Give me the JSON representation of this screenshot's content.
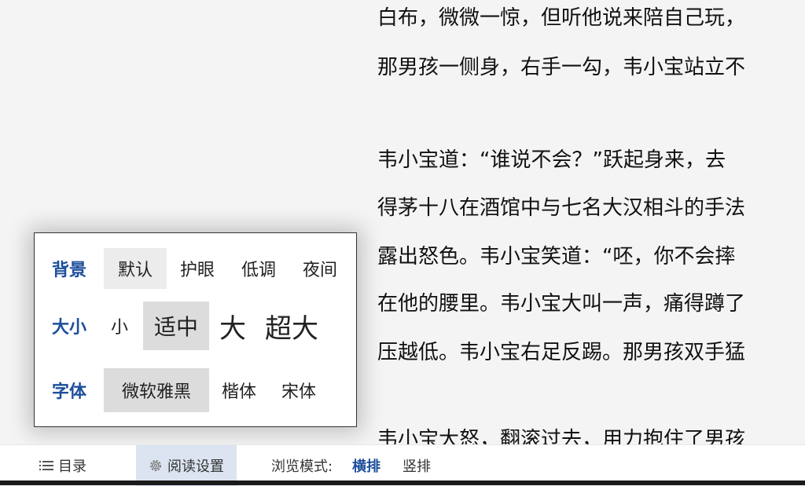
{
  "content": {
    "lines": [
      "白布，微微一惊，但听他说来陪自己玩，",
      "那男孩一侧身，右手一勾，韦小宝站立不",
      "韦小宝道：“谁说不会？”跃起身来，去",
      "得茅十八在酒馆中与七名大汉相斗的手法",
      "露出怒色。韦小宝笑道：“呸，你不会摔",
      "在他的腰里。韦小宝大叫一声，痛得蹲了",
      "压越低。韦小宝右足反踢。那男孩双手猛",
      "韦小宝大怒，翻滚过去，用力抱住了男孩"
    ]
  },
  "settings_panel": {
    "background": {
      "label": "背景",
      "options": [
        "默认",
        "护眼",
        "低调",
        "夜间"
      ],
      "selected": "默认"
    },
    "size": {
      "label": "大小",
      "options": [
        "小",
        "适中",
        "大",
        "超大"
      ],
      "selected": "适中"
    },
    "font": {
      "label": "字体",
      "options": [
        "微软雅黑",
        "楷体",
        "宋体"
      ],
      "selected": "微软雅黑"
    }
  },
  "bottom_bar": {
    "toc_label": "目录",
    "settings_label": "阅读设置",
    "mode_label": "浏览模式:",
    "mode_options": [
      "横排",
      "竖排"
    ],
    "mode_selected": "横排"
  },
  "colors": {
    "accent": "#1d4f9b",
    "selected_bg": "#dcdcdc",
    "settings_active_bg": "#dbe4f0"
  },
  "icons": {
    "toc": "list-icon",
    "settings": "gear-icon"
  }
}
